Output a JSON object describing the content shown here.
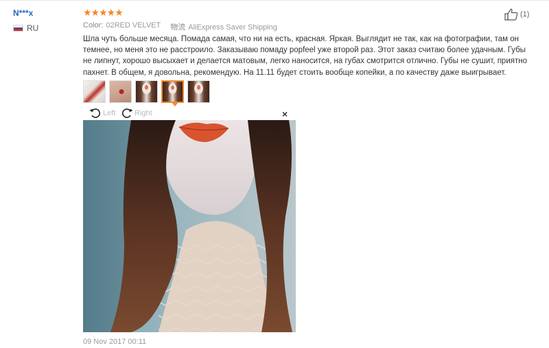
{
  "user": {
    "name": "N***x",
    "country": "RU"
  },
  "review": {
    "stars": "★★★★★",
    "color_label": "Color:",
    "color_value": "02RED VELVET",
    "shipping_label": "物流",
    "shipping_value": "AliExpress Saver Shipping",
    "text": "Шла чуть больше месяца. Помада самая, что ни на есть, красная. Яркая. Выглядит не так, как на фотографии, там он темнее, но меня это не расстроило. Заказываю помаду popfeel уже второй раз. Этот заказ считаю более удачным. Губы не липнут, хорошо высыхает и делается матовым, легко наносится, на губах смотрится отлично. Губы не сушит, приятно пахнет. В общем, я довольна, рекомендую. На 11.11 будет стоить вообще копейки, а по качеству даже выигрывает.",
    "date": "09 Nov 2017 00:11",
    "helpful_count": "(1)"
  },
  "viewer": {
    "rotate_left": "Left",
    "rotate_right": "Right",
    "close": "×"
  },
  "colors": {
    "star": "#f5882a",
    "username": "#2a65c0",
    "accent": "#f5882a"
  },
  "icons": {
    "helpful": "thumbs-up-icon",
    "flag": "russia-flag-icon",
    "rotate_left": "rotate-left-icon",
    "rotate_right": "rotate-right-icon",
    "close": "close-icon"
  },
  "thumbnails": {
    "count": 5,
    "active_index": 3
  }
}
